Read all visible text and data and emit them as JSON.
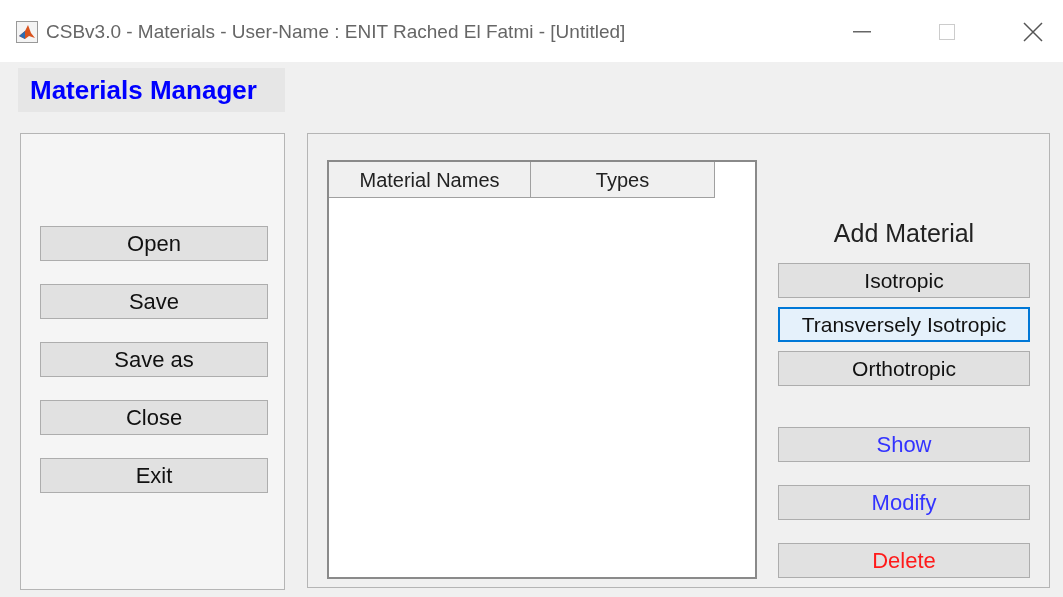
{
  "window": {
    "title": "CSBv3.0 - Materials - User-Name : ENIT Rached El Fatmi - [Untitled]"
  },
  "header": "Materials Manager",
  "file_buttons": [
    {
      "label": "Open"
    },
    {
      "label": "Save"
    },
    {
      "label": "Save as"
    },
    {
      "label": "Close"
    },
    {
      "label": "Exit"
    }
  ],
  "table": {
    "columns": [
      "Material Names",
      "Types"
    ]
  },
  "add_material": {
    "title": "Add Material",
    "buttons": [
      {
        "label": "Isotropic",
        "focused": false
      },
      {
        "label": "Transversely Isotropic",
        "focused": true
      },
      {
        "label": "Orthotropic",
        "focused": false
      }
    ]
  },
  "actions": [
    {
      "label": "Show",
      "color": "#3333ff"
    },
    {
      "label": "Modify",
      "color": "#3333ff"
    },
    {
      "label": "Delete",
      "color": "#ff1a1a"
    }
  ]
}
